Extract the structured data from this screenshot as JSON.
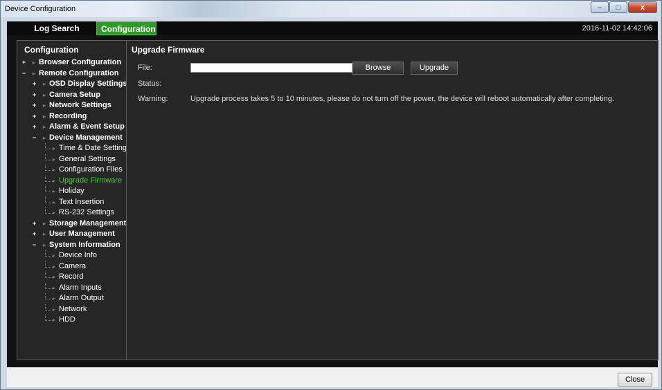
{
  "window": {
    "title": "Device Configuration",
    "controls": {
      "minimize": "–",
      "maximize": "□",
      "close": "x"
    }
  },
  "tabs": [
    {
      "label": "Log Search",
      "active": false
    },
    {
      "label": "Configuration",
      "active": true
    }
  ],
  "datetime": "2016-11-02 14:42:06",
  "sidebar": {
    "title": "Configuration",
    "items": [
      {
        "label": "Browser Configuration",
        "level": 0,
        "expander": "+",
        "bold": true
      },
      {
        "label": "Remote Configuration",
        "level": 0,
        "expander": "−",
        "bold": true
      },
      {
        "label": "OSD Display Settings",
        "level": 1,
        "expander": "+",
        "bold": true
      },
      {
        "label": "Camera Setup",
        "level": 1,
        "expander": "+",
        "bold": true
      },
      {
        "label": "Network Settings",
        "level": 1,
        "expander": "+",
        "bold": true
      },
      {
        "label": "Recording",
        "level": 1,
        "expander": "+",
        "bold": true
      },
      {
        "label": "Alarm & Event Setup",
        "level": 1,
        "expander": "+",
        "bold": true
      },
      {
        "label": "Device Management",
        "level": 1,
        "expander": "−",
        "bold": true
      },
      {
        "label": "Time & Date Settings",
        "level": 2
      },
      {
        "label": "General Settings",
        "level": 2
      },
      {
        "label": "Configuration Files",
        "level": 2
      },
      {
        "label": "Upgrade Firmware",
        "level": 2,
        "active": true
      },
      {
        "label": "Holiday",
        "level": 2
      },
      {
        "label": "Text Insertion",
        "level": 2
      },
      {
        "label": "RS-232 Settings",
        "level": 2
      },
      {
        "label": "Storage Management",
        "level": 1,
        "expander": "+",
        "bold": true
      },
      {
        "label": "User Management",
        "level": 1,
        "expander": "+",
        "bold": true
      },
      {
        "label": "System Information",
        "level": 1,
        "expander": "−",
        "bold": true
      },
      {
        "label": "Device Info",
        "level": 2
      },
      {
        "label": "Camera",
        "level": 2
      },
      {
        "label": "Record",
        "level": 2
      },
      {
        "label": "Alarm Inputs",
        "level": 2
      },
      {
        "label": "Alarm Output",
        "level": 2
      },
      {
        "label": "Network",
        "level": 2
      },
      {
        "label": "HDD",
        "level": 2
      }
    ]
  },
  "main": {
    "title": "Upgrade Firmware",
    "file_label": "File:",
    "file_value": "",
    "browse_label": "Browse",
    "upgrade_label": "Upgrade",
    "status_label": "Status:",
    "status_value": "",
    "warning_label": "Warning:",
    "warning_text": "Upgrade process takes 5 to 10 minutes, please do not turn off the power, the device will reboot automatically after completing."
  },
  "footer": {
    "close_label": "Close"
  },
  "colors": {
    "accent": "#2f9a2a",
    "active_item": "#4ccc3f",
    "panel_bg": "#262626"
  }
}
